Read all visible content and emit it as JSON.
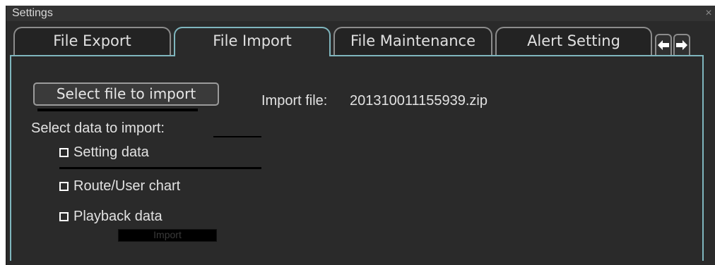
{
  "window": {
    "title": "Settings",
    "close_glyph": "×"
  },
  "tabs": [
    {
      "label": "File Export",
      "active": false
    },
    {
      "label": "File Import",
      "active": true
    },
    {
      "label": "File Maintenance",
      "active": false
    },
    {
      "label": "Alert Setting",
      "active": false
    }
  ],
  "tab_scroll": {
    "left_glyph": "🡐",
    "right_glyph": "🡒"
  },
  "file_import": {
    "select_button_label": "Select file to import",
    "import_file_label": "Import file:",
    "import_file_value": "201310011155939.zip",
    "select_data_label": "Select data to import:",
    "options": [
      {
        "label": "Setting data",
        "checked": false
      },
      {
        "label": "Route/User chart",
        "checked": false
      },
      {
        "label": "Playback data",
        "checked": false
      }
    ],
    "import_button_label": "Import"
  },
  "colors": {
    "background": "#2a2a2a",
    "active_tab_border": "#7fb6be",
    "inactive_tab_border": "#8c8c8c",
    "text": "#e2e2e2"
  }
}
